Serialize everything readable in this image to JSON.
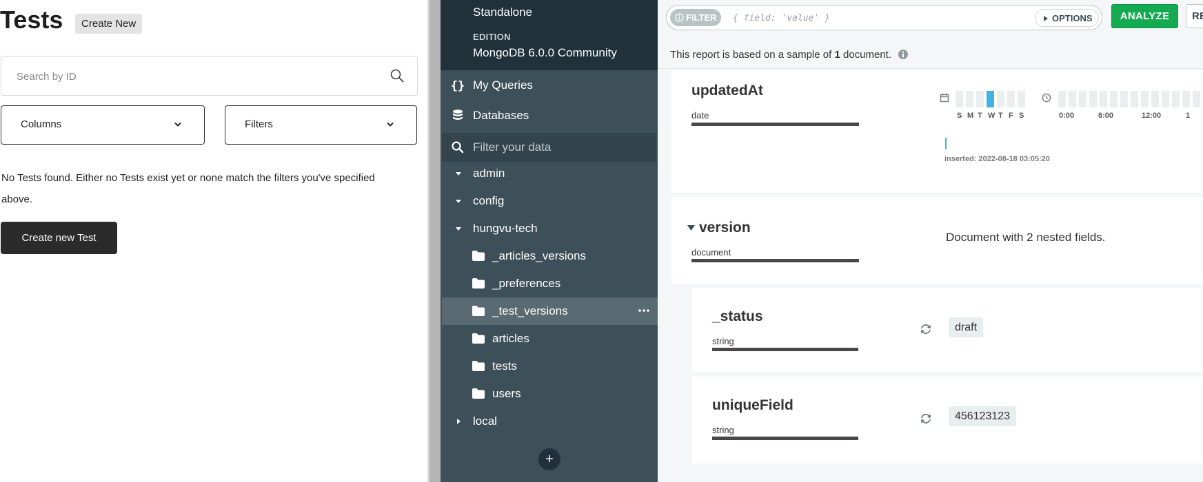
{
  "left": {
    "title": "Tests",
    "create_new_label": "Create New",
    "search_placeholder": "Search by ID",
    "columns_label": "Columns",
    "filters_label": "Filters",
    "empty_message": "No Tests found. Either no Tests exist yet or none match the filters you've specified above.",
    "create_test_label": "Create new Test"
  },
  "sidebar": {
    "topology": "Standalone",
    "edition_label": "EDITION",
    "edition": "MongoDB 6.0.0 Community",
    "my_queries": "My Queries",
    "databases": "Databases",
    "filter_placeholder": "Filter your data",
    "dbs": [
      {
        "name": "admin",
        "expanded": true
      },
      {
        "name": "config",
        "expanded": true
      },
      {
        "name": "hungvu-tech",
        "expanded": true
      },
      {
        "name": "local",
        "expanded": false
      }
    ],
    "collections": [
      {
        "name": "_articles_versions"
      },
      {
        "name": "_preferences"
      },
      {
        "name": "_test_versions",
        "active": true
      },
      {
        "name": "articles"
      },
      {
        "name": "tests"
      },
      {
        "name": "users"
      }
    ],
    "add_label": "+"
  },
  "main": {
    "filter_pill": "FILTER",
    "filter_placeholder": "{ field: 'value' }",
    "options_label": "OPTIONS",
    "analyze_label": "ANALYZE",
    "reset_label": "RE",
    "sample_prefix": "This report is based on a sample of ",
    "sample_count": "1",
    "sample_suffix": " document.",
    "fields": {
      "updated_at": {
        "name": "updatedAt",
        "type": "date",
        "days": [
          "S",
          "M",
          "T",
          "W",
          "T",
          "F",
          "S"
        ],
        "hours": [
          "0:00",
          "6:00",
          "12:00",
          "1"
        ],
        "inserted": "inserted: 2022-08-18 03:05:20"
      },
      "version": {
        "name": "version",
        "type": "document",
        "summary": "Document with 2 nested fields."
      },
      "status": {
        "name": "_status",
        "type": "string",
        "value": "draft"
      },
      "unique_field": {
        "name": "uniqueField",
        "type": "string",
        "value": "456123123"
      }
    }
  },
  "colors": {
    "sidebar_bg": "#3d4f58",
    "sidebar_top": "#20313a",
    "active_row": "#5a6a72",
    "analyze": "#13aa52",
    "histogram_hit": "#43b1e5"
  }
}
